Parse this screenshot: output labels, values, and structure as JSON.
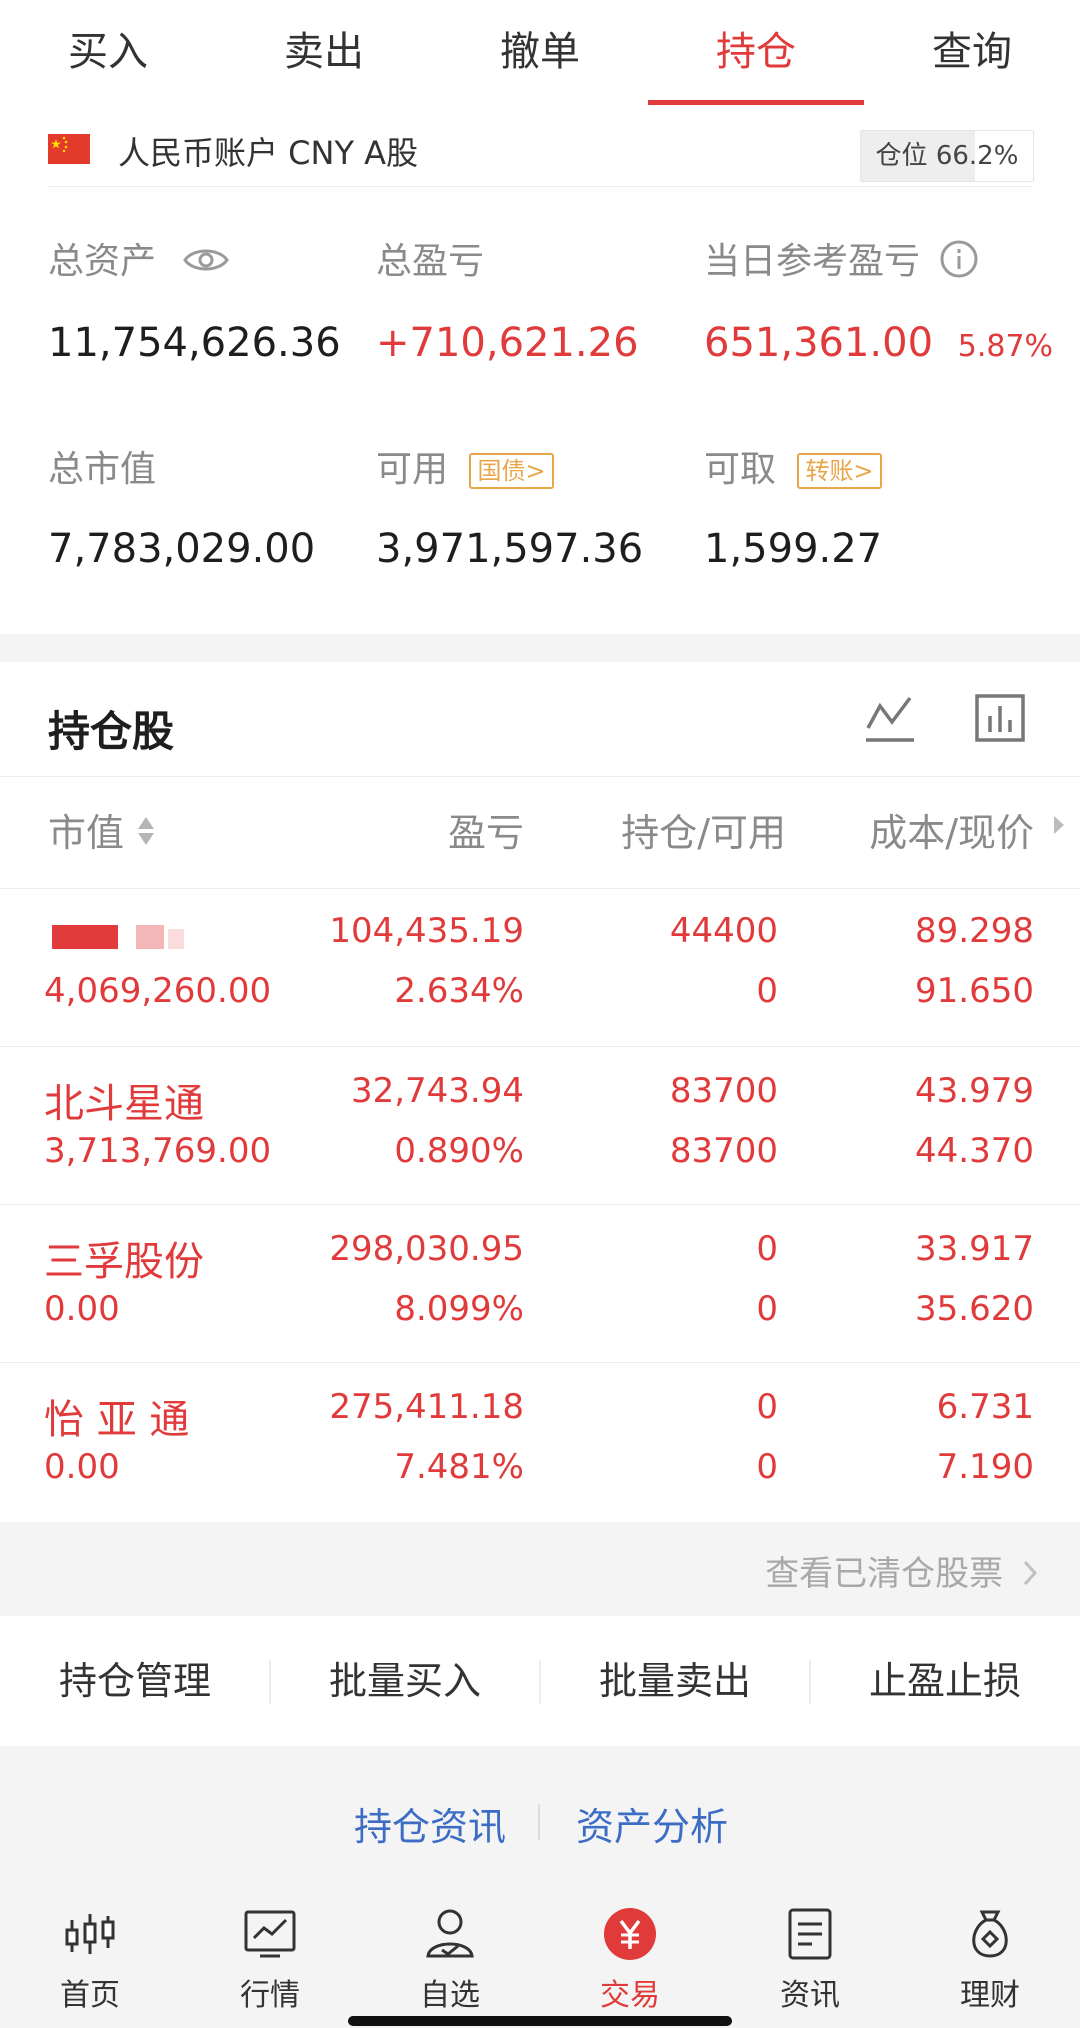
{
  "tabs": [
    "买入",
    "卖出",
    "撤单",
    "持仓",
    "查询"
  ],
  "account": {
    "name": "人民币账户 CNY A股",
    "position_label": "仓位",
    "position_value": "66.2%",
    "position_fraction": 0.662
  },
  "summary": {
    "total_assets_label": "总资产",
    "total_assets": "11,754,626.36",
    "total_pl_label": "总盈亏",
    "total_pl": "+710,621.26",
    "day_pl_label": "当日参考盈亏",
    "day_pl": "651,361.00",
    "day_pl_pct": "5.87%",
    "market_value_label": "总市值",
    "market_value": "7,783,029.00",
    "available_label": "可用",
    "available_tag": "国债>",
    "available": "3,971,597.36",
    "withdrawable_label": "可取",
    "withdrawable_tag": "转账>",
    "withdrawable": "1,599.27"
  },
  "holdings": {
    "title": "持仓股",
    "columns": [
      "市值",
      "盈亏",
      "持仓/可用",
      "成本/现价"
    ],
    "rows": [
      {
        "name": "",
        "market_value": "4,069,260.00",
        "pl": "104,435.19",
        "pl_pct": "2.634%",
        "position": "44400",
        "available": "0",
        "cost": "89.298",
        "price": "91.650"
      },
      {
        "name": "北斗星通",
        "market_value": "3,713,769.00",
        "pl": "32,743.94",
        "pl_pct": "0.890%",
        "position": "83700",
        "available": "83700",
        "cost": "43.979",
        "price": "44.370"
      },
      {
        "name": "三孚股份",
        "market_value": "0.00",
        "pl": "298,030.95",
        "pl_pct": "8.099%",
        "position": "0",
        "available": "0",
        "cost": "33.917",
        "price": "35.620"
      },
      {
        "name": "怡 亚 通",
        "market_value": "0.00",
        "pl": "275,411.18",
        "pl_pct": "7.481%",
        "position": "0",
        "available": "0",
        "cost": "6.731",
        "price": "7.190"
      }
    ],
    "cleared_link": "查看已清仓股票"
  },
  "actions": [
    "持仓管理",
    "批量买入",
    "批量卖出",
    "止盈止损"
  ],
  "links": [
    "持仓资讯",
    "资产分析"
  ],
  "nav": [
    {
      "label": "首页",
      "icon": "home-candlestick-icon"
    },
    {
      "label": "行情",
      "icon": "market-chart-icon"
    },
    {
      "label": "自选",
      "icon": "watchlist-user-icon"
    },
    {
      "label": "交易",
      "icon": "trade-yuan-icon"
    },
    {
      "label": "资讯",
      "icon": "news-document-icon"
    },
    {
      "label": "理财",
      "icon": "wealth-bag-icon"
    }
  ],
  "colors": {
    "accent": "#e03a3a",
    "link": "#3c6cc4",
    "tag": "#e8a64a"
  }
}
